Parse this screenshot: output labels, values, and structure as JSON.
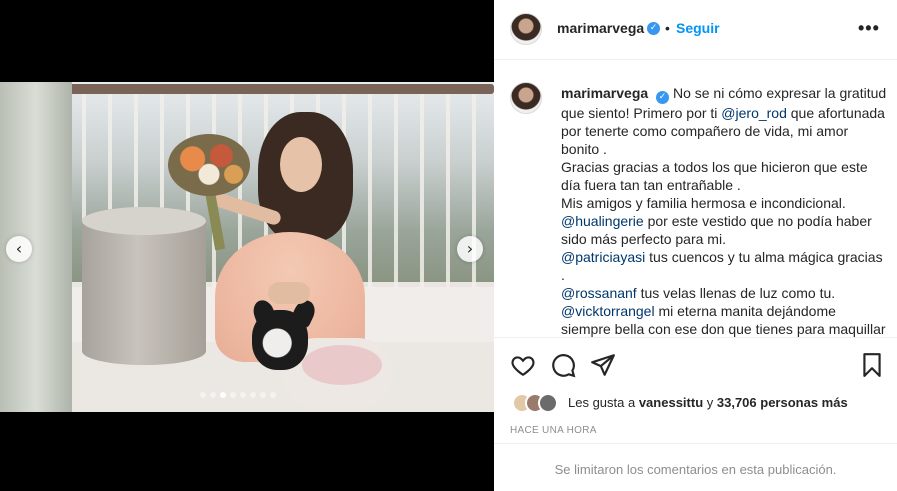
{
  "post": {
    "username": "marimarvega",
    "verified_icon": "verified-badge-icon",
    "follow_label": "Seguir",
    "header_separator": "•",
    "more_label": "•••",
    "verified_glyph": "✓"
  },
  "caption": {
    "username": "marimarvega",
    "lines": {
      "l1_a": "No se ni cómo expresar la gratitud que siento! Primero por ti ",
      "l1_mention": "@jero_rod",
      "l1_b": " que afortunada por tenerte como compañero de vida, mi amor bonito .",
      "l2": "Gracias gracias a todos los que hicieron que este día fuera tan tan entrañable .",
      "l3": "Mis amigos y familia hermosa e incondicional.",
      "l4_mention": "@hualingerie",
      "l4_b": " por este vestido que no podía haber sido más perfecto para mi.",
      "l5_mention": "@patriciayasi",
      "l5_b": " tus cuencos y tu alma mágica gracias .",
      "l6_mention": "@rossananf",
      "l6_b": " tus velas llenas de luz como tu.",
      "l7_mention": "@vicktorrangel",
      "l7_b": " mi eterna manita dejándome siempre bella con ese don que tienes para maquillar y peinar ."
    }
  },
  "carousel": {
    "prev_glyph": "‹",
    "next_glyph": "›",
    "dot_count": 8,
    "active_dot": 2
  },
  "likes": {
    "prefix": "Les gusta a ",
    "user": "vanessittu",
    "middle": " y ",
    "count": "33,706 personas más"
  },
  "time": "Hace una hora",
  "comments_notice": "Se limitaron los comentarios en esta publicación.",
  "colors": {
    "accent": "#0095f6",
    "mention": "#00376b",
    "muted": "#8e8e8e",
    "text": "#262626"
  }
}
